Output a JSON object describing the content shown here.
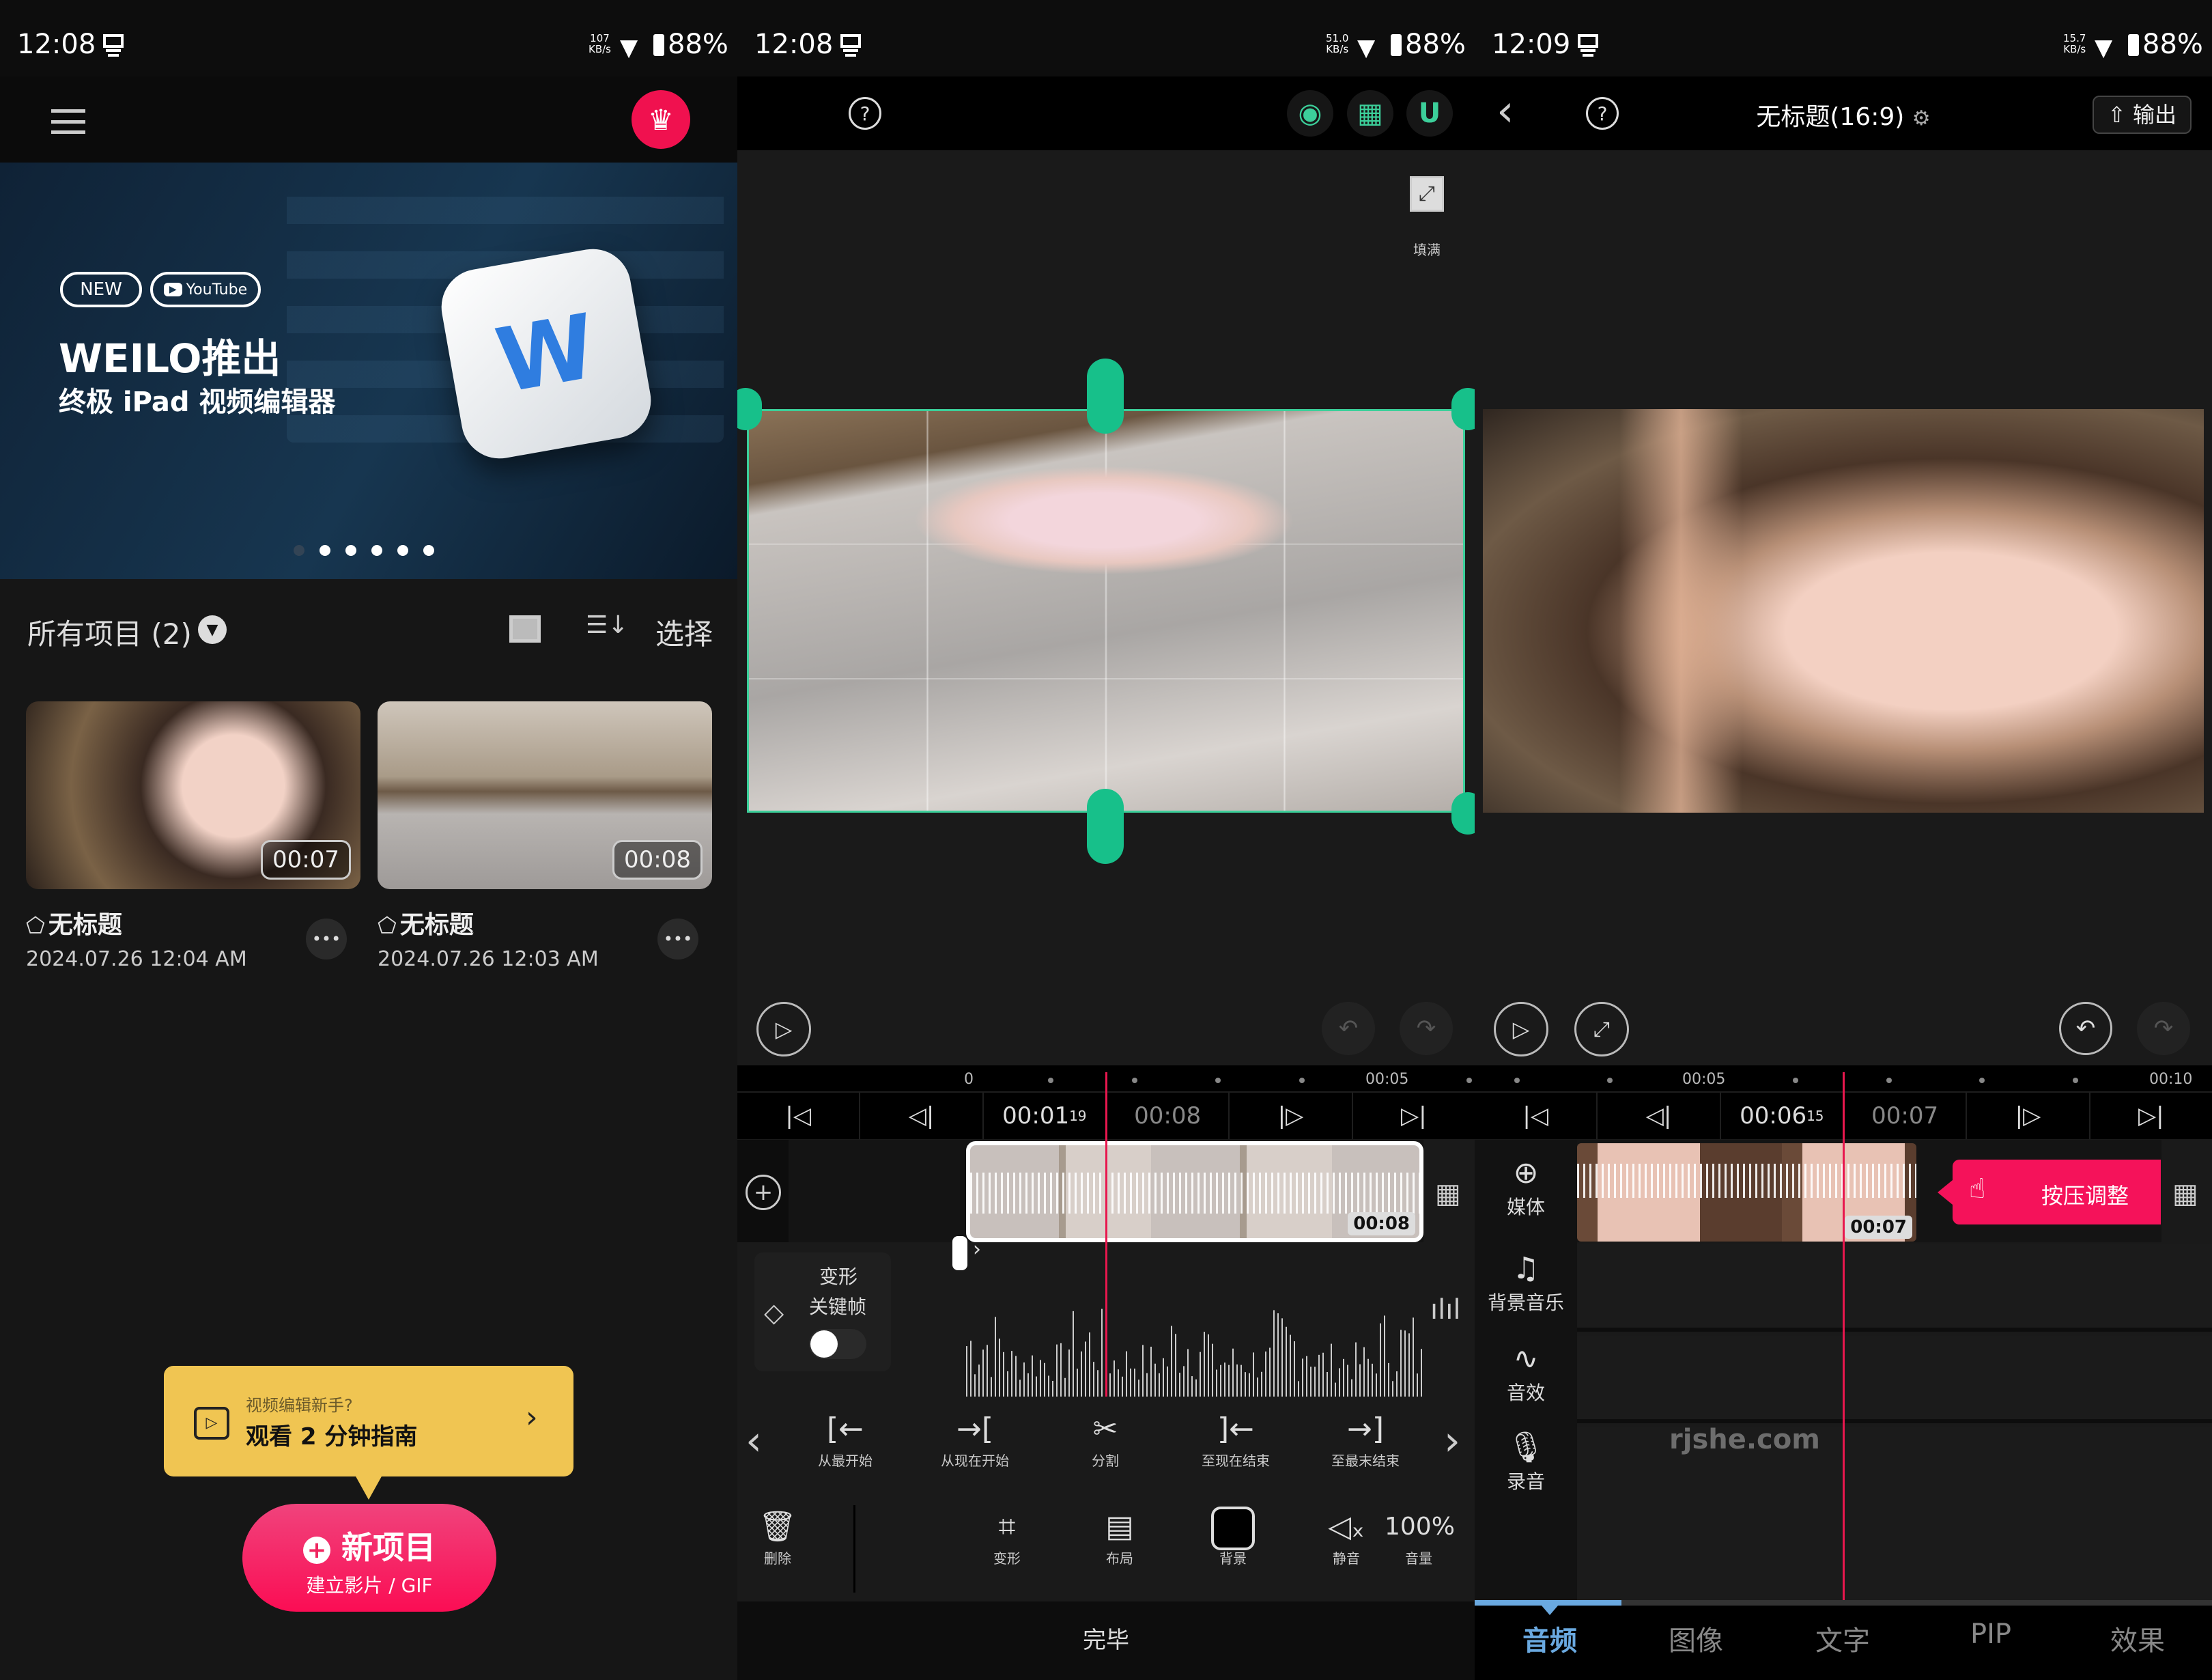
{
  "colors": {
    "accent_pink": "#f5125a",
    "green": "#3ccf9a",
    "guide_yellow": "#f0c552",
    "tab_active": "#6aa9e0",
    "playhead": "#e8174e"
  },
  "panels": [
    {
      "status": {
        "time": "12:08",
        "speed_value": "107",
        "speed_unit": "KB/s",
        "battery": "88%"
      }
    },
    {
      "status": {
        "time": "12:08",
        "speed_value": "51.0",
        "speed_unit": "KB/s",
        "battery": "88%"
      }
    },
    {
      "status": {
        "time": "12:09",
        "speed_value": "15.7",
        "speed_unit": "KB/s",
        "battery": "88%"
      }
    }
  ],
  "home": {
    "menu_icon": "hamburger-icon",
    "premium_icon": "crown-icon",
    "banner": {
      "badge_new": "NEW",
      "badge_youtube": "YouTube",
      "title": "WEILO推出",
      "subtitle": "终极 iPad 视频编辑器",
      "slide_count": 5
    },
    "section": {
      "title": "所有项目 (2)",
      "select": "选择"
    },
    "projects": [
      {
        "title": "无标题",
        "date": "2024.07.26  12:04 AM",
        "duration": "00:07"
      },
      {
        "title": "无标题",
        "date": "2024.07.26  12:03 AM",
        "duration": "00:08"
      }
    ],
    "guide": {
      "question": "视频编辑新手?",
      "action": "观看 2 分钟指南"
    },
    "new_project": {
      "label": "新项目",
      "sublabel": "建立影片 / GIF"
    }
  },
  "editor": {
    "fill_label": "填满",
    "ruler": {
      "start": "0",
      "mid": "00:05"
    },
    "current_time": "00:01",
    "current_frames": "19",
    "total_time": "00:08",
    "clip_duration": "00:08",
    "keyframe": {
      "title": "变形",
      "subtitle": "关键帧",
      "enabled": false
    },
    "tools": [
      "从最开始",
      "从现在开始",
      "分割",
      "至现在结束",
      "至最末结束"
    ],
    "bottom_tools": [
      {
        "label": "删除"
      },
      {
        "label": "变形"
      },
      {
        "label": "布局"
      },
      {
        "label": "背景"
      },
      {
        "label": "静音"
      },
      {
        "label": "音量",
        "value": "100%"
      }
    ],
    "done": "完毕"
  },
  "project": {
    "title": "无标题(16:9)",
    "export": "输出",
    "ruler": {
      "a": "00:05",
      "b": "00:10"
    },
    "current_time": "00:06",
    "current_frames": "15",
    "total_time": "00:07",
    "clip_duration": "00:07",
    "hint": "按压调整",
    "side": [
      "媒体",
      "背景音乐",
      "音效",
      "录音"
    ],
    "watermark": "rjshe.com",
    "tabs": [
      "音频",
      "图像",
      "文字",
      "PIP",
      "效果"
    ],
    "active_tab": "音频"
  }
}
